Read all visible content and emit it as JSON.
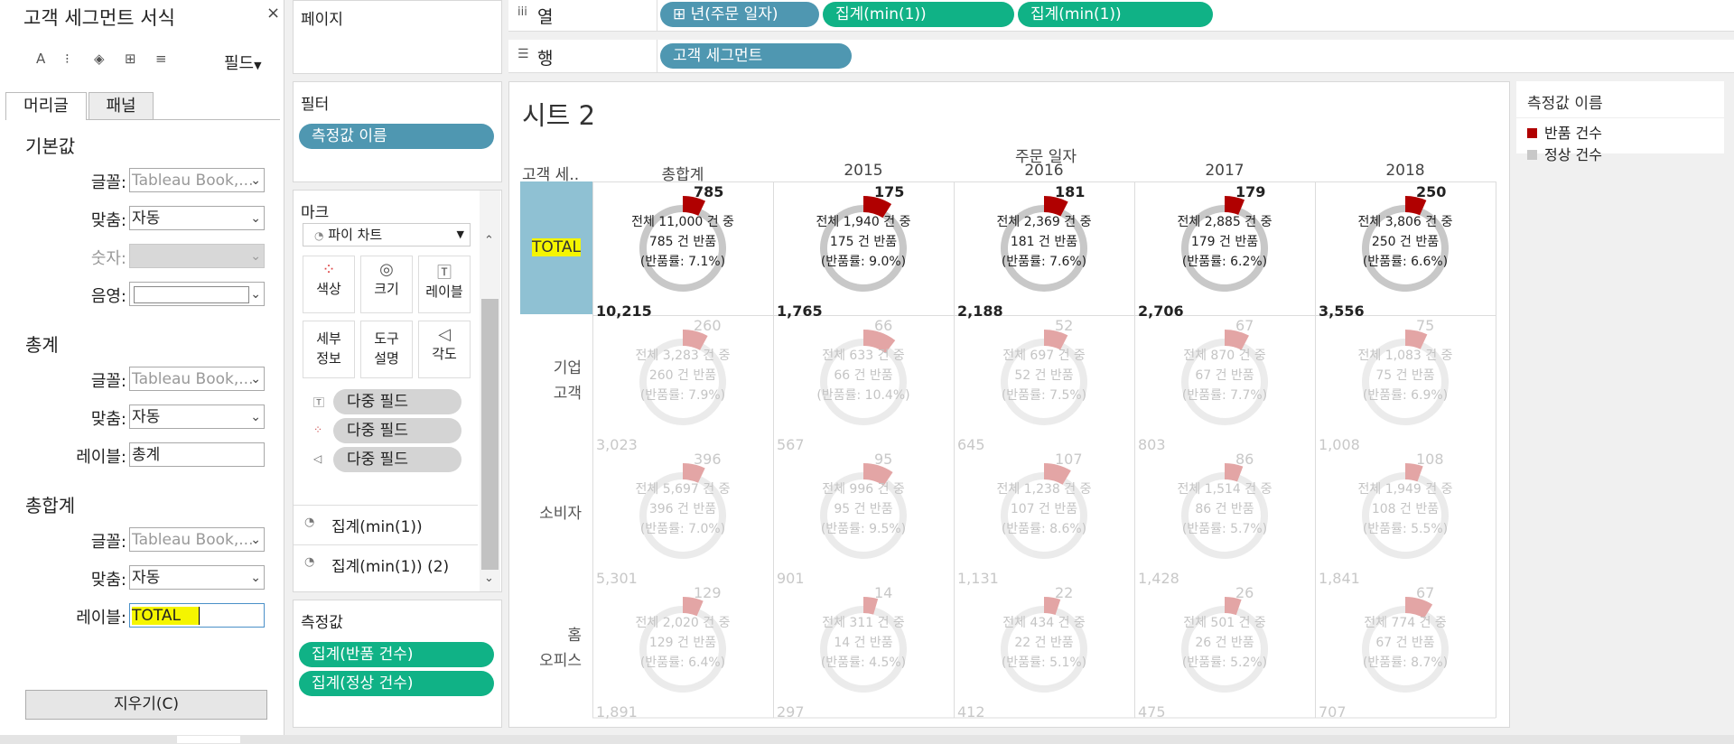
{
  "format_pane": {
    "title": "고객 세그먼트 서식",
    "close": "×",
    "tool_a": "A",
    "tool_align": "⁝",
    "tool_shade": "◈",
    "tool_border": "⊞",
    "tool_lines": "≡",
    "field_button": "필드",
    "tabs": [
      "머리글",
      "패널"
    ],
    "default": {
      "heading": "기본값",
      "font_label": "글꼴:",
      "font_value": "Tableau Book,...",
      "align_label": "맞춤:",
      "align_value": "자동",
      "number_label": "숫자:",
      "shade_label": "음영:"
    },
    "totals": {
      "heading": "총계",
      "font_label": "글꼴:",
      "font_value": "Tableau Book,...",
      "align_label": "맞춤:",
      "align_value": "자동",
      "label_label": "레이블:",
      "label_value": "총계"
    },
    "grand": {
      "heading": "총합계",
      "font_label": "글꼴:",
      "font_value": "Tableau Book,...",
      "align_label": "맞춤:",
      "align_value": "자동",
      "label_label": "레이블:",
      "label_value": "TOTAL"
    },
    "clear_button": "지우기(C)"
  },
  "shelves": {
    "pages": "페이지",
    "filters": "필터",
    "filter_pill": "측정값 이름",
    "marks": "마크",
    "mark_type": "파이 차트",
    "mark_buttons": [
      "색상",
      "크기",
      "레이블",
      "세부\n정보",
      "도구\n설명",
      "각도"
    ],
    "multi_fields": [
      "다중 필드",
      "다중 필드",
      "다중 필드"
    ],
    "aggregates": [
      "집계(min(1))",
      "집계(min(1)) (2)"
    ],
    "measures": "측정값",
    "measure_pills": [
      "집계(반품 건수)",
      "집계(정상 건수)"
    ],
    "columns_label": "열",
    "columns_icon": "iii",
    "column_pills": [
      "⊞ 년(주문 일자)",
      "집계(min(1))",
      "집계(min(1))"
    ],
    "rows_label": "행",
    "rows_icon": "☰",
    "row_pills": [
      "고객 세그먼트"
    ]
  },
  "view": {
    "sheet_title": "시트 2",
    "col_group_header": "주문 일자",
    "row_header": "고객 세..",
    "columns": [
      "총합계",
      "2015",
      "2016",
      "2017",
      "2018"
    ],
    "rows": [
      "TOTAL",
      "기업\n고객",
      "소비자",
      "홈\n오피스"
    ],
    "cells": [
      [
        {
          "l1": "전체 11,000 건 중",
          "l2": "785 건 반품",
          "l3": "(반품률: 7.1%)",
          "ret": "785",
          "norm": "10,215",
          "rate": 0.071
        },
        {
          "l1": "전체 1,940 건 중",
          "l2": "175 건 반품",
          "l3": "(반품률: 9.0%)",
          "ret": "175",
          "norm": "1,765",
          "rate": 0.09
        },
        {
          "l1": "전체 2,369 건 중",
          "l2": "181 건 반품",
          "l3": "(반품률: 7.6%)",
          "ret": "181",
          "norm": "2,188",
          "rate": 0.076
        },
        {
          "l1": "전체 2,885 건 중",
          "l2": "179 건 반품",
          "l3": "(반품률: 6.2%)",
          "ret": "179",
          "norm": "2,706",
          "rate": 0.062
        },
        {
          "l1": "전체 3,806 건 중",
          "l2": "250 건 반품",
          "l3": "(반품률: 6.6%)",
          "ret": "250",
          "norm": "3,556",
          "rate": 0.066
        }
      ],
      [
        {
          "l1": "전체 3,283 건 중",
          "l2": "260 건 반품",
          "l3": "(반품률: 7.9%)",
          "ret": "260",
          "norm": "3,023",
          "rate": 0.079
        },
        {
          "l1": "전체 633 건 중",
          "l2": "66 건 반품",
          "l3": "(반품률: 10.4%)",
          "ret": "66",
          "norm": "567",
          "rate": 0.104
        },
        {
          "l1": "전체 697 건 중",
          "l2": "52 건 반품",
          "l3": "(반품률: 7.5%)",
          "ret": "52",
          "norm": "645",
          "rate": 0.075
        },
        {
          "l1": "전체 870 건 중",
          "l2": "67 건 반품",
          "l3": "(반품률: 7.7%)",
          "ret": "67",
          "norm": "803",
          "rate": 0.077
        },
        {
          "l1": "전체 1,083 건 중",
          "l2": "75 건 반품",
          "l3": "(반품률: 6.9%)",
          "ret": "75",
          "norm": "1,008",
          "rate": 0.069
        }
      ],
      [
        {
          "l1": "전체 5,697 건 중",
          "l2": "396 건 반품",
          "l3": "(반품률: 7.0%)",
          "ret": "396",
          "norm": "5,301",
          "rate": 0.07
        },
        {
          "l1": "전체 996 건 중",
          "l2": "95 건 반품",
          "l3": "(반품률: 9.5%)",
          "ret": "95",
          "norm": "901",
          "rate": 0.095
        },
        {
          "l1": "전체 1,238 건 중",
          "l2": "107 건 반품",
          "l3": "(반품률: 8.6%)",
          "ret": "107",
          "norm": "1,131",
          "rate": 0.086
        },
        {
          "l1": "전체 1,514 건 중",
          "l2": "86 건 반품",
          "l3": "(반품률: 5.7%)",
          "ret": "86",
          "norm": "1,428",
          "rate": 0.057
        },
        {
          "l1": "전체 1,949 건 중",
          "l2": "108 건 반품",
          "l3": "(반품률: 5.5%)",
          "ret": "108",
          "norm": "1,841",
          "rate": 0.055
        }
      ],
      [
        {
          "l1": "전체 2,020 건 중",
          "l2": "129 건 반품",
          "l3": "(반품률: 6.4%)",
          "ret": "129",
          "norm": "1,891",
          "rate": 0.064
        },
        {
          "l1": "전체 311 건 중",
          "l2": "14 건 반품",
          "l3": "(반품률: 4.5%)",
          "ret": "14",
          "norm": "297",
          "rate": 0.045
        },
        {
          "l1": "전체 434 건 중",
          "l2": "22 건 반품",
          "l3": "(반품률: 5.1%)",
          "ret": "22",
          "norm": "412",
          "rate": 0.051
        },
        {
          "l1": "전체 501 건 중",
          "l2": "26 건 반품",
          "l3": "(반품률: 5.2%)",
          "ret": "26",
          "norm": "475",
          "rate": 0.052
        },
        {
          "l1": "전체 774 건 중",
          "l2": "67 건 반품",
          "l3": "(반품률: 8.7%)",
          "ret": "67",
          "norm": "707",
          "rate": 0.087
        }
      ]
    ]
  },
  "legend": {
    "title": "측정값 이름",
    "items": [
      {
        "label": "반품 건수",
        "color": "#b00000"
      },
      {
        "label": "정상 건수",
        "color": "#c8c8c8"
      }
    ]
  },
  "colors": {
    "returned": "#b00000",
    "normal": "#c8c8c8",
    "total_cell": "#8fc1d3",
    "highlight": "#f5f500"
  }
}
